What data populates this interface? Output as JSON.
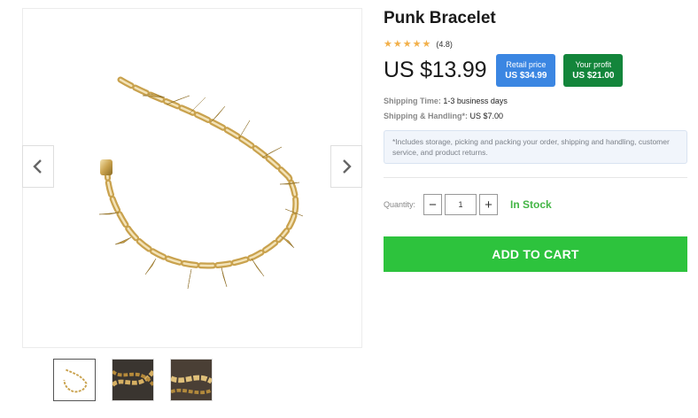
{
  "product": {
    "title": "Punk Bracelet",
    "rating": "(4.8)",
    "stars": 5,
    "price": "US $13.99",
    "retail_label": "Retail price",
    "retail_value": "US $34.99",
    "profit_label": "Your profit",
    "profit_value": "US $21.00"
  },
  "shipping": {
    "time_label": "Shipping Time:",
    "time_value": "1-3 business days",
    "handling_label": "Shipping & Handling*:",
    "handling_value": "US $7.00",
    "note": "*Includes storage, picking and packing your order, shipping and handling, customer service, and product returns."
  },
  "quantity": {
    "label": "Quantity:",
    "value": "1",
    "minus": "−",
    "plus": "+",
    "stock": "In Stock"
  },
  "cart": {
    "label": "ADD TO CART"
  },
  "colors": {
    "retail_badge": "#3b86e2",
    "profit_badge": "#13853b",
    "add_to_cart": "#2dc33d",
    "in_stock": "#43b545",
    "stars": "#f2b04a"
  },
  "icons": {
    "prev": "chevron-left-icon",
    "next": "chevron-right-icon",
    "star": "star-icon"
  }
}
